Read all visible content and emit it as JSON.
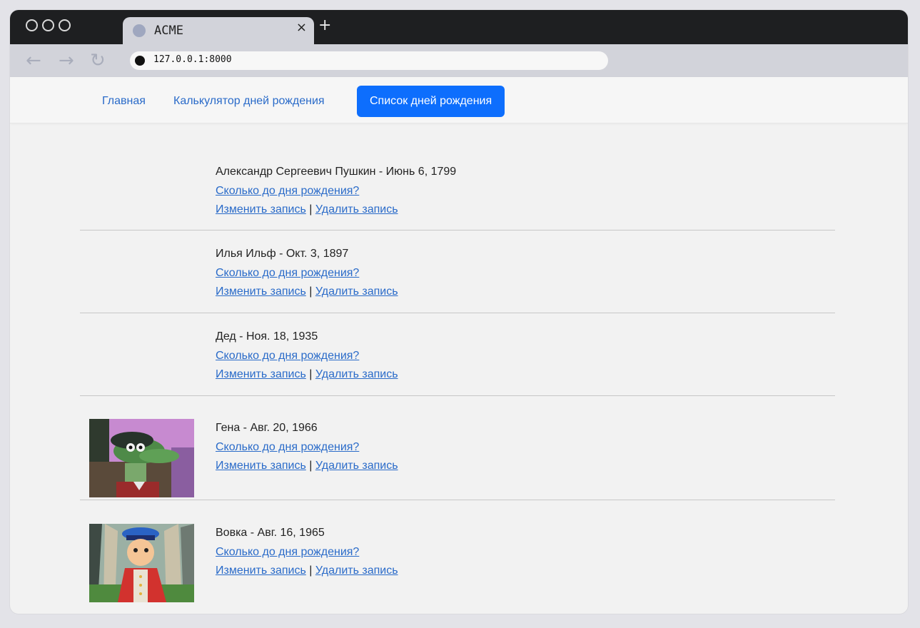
{
  "browser": {
    "tab_title": "ACME",
    "tab_close": "×",
    "new_tab": "+",
    "url": "127.0.0.1:8000",
    "back_glyph": "←",
    "forward_glyph": "→",
    "reload_glyph": "↻"
  },
  "nav": {
    "home": "Главная",
    "calculator": "Калькулятор дней рождения",
    "list": "Список дней рождения"
  },
  "colors": {
    "accent": "#0d6efd",
    "link": "#2a6bc9"
  },
  "entries": [
    {
      "title": "Александр Сергеевич Пушкин - Июнь 6, 1799",
      "countdown": "Сколько до дня рождения?",
      "edit": "Изменить запись",
      "separator": " | ",
      "delete": "Удалить запись",
      "has_photo": false
    },
    {
      "title": "Илья Ильф - Окт. 3, 1897",
      "countdown": "Сколько до дня рождения?",
      "edit": "Изменить запись",
      "separator": " | ",
      "delete": "Удалить запись",
      "has_photo": false
    },
    {
      "title": "Дед - Ноя. 18, 1935",
      "countdown": "Сколько до дня рождения?",
      "edit": "Изменить запись",
      "separator": " | ",
      "delete": "Удалить запись",
      "has_photo": false
    },
    {
      "title": "Гена - Авг. 20, 1966",
      "countdown": "Сколько до дня рождения?",
      "edit": "Изменить запись",
      "separator": " | ",
      "delete": "Удалить запись",
      "has_photo": true,
      "photo": "crocodile-gena-photo"
    },
    {
      "title": "Вовка - Авг. 16, 1965",
      "countdown": "Сколько до дня рождения?",
      "edit": "Изменить запись",
      "separator": " | ",
      "delete": "Удалить запись",
      "has_photo": true,
      "photo": "vovka-cartoon-photo"
    }
  ]
}
